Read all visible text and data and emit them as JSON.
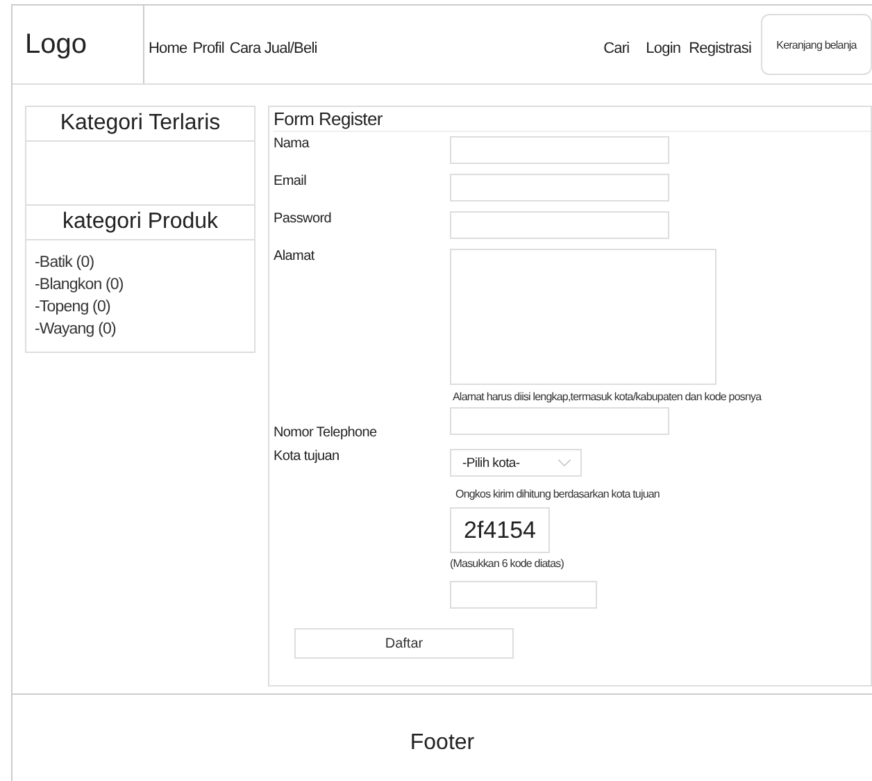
{
  "header": {
    "logo": "Logo",
    "nav_left": [
      "Home",
      "Profil",
      "Cara Jual/Beli"
    ],
    "nav_right": [
      "Cari",
      "Login",
      "Registrasi"
    ],
    "cart_button": "Keranjang belanja"
  },
  "sidebar": {
    "bestseller_title": "Kategori Terlaris",
    "category_title": "kategori Produk",
    "categories": [
      "-Batik (0)",
      "-Blangkon (0)",
      "-Topeng (0)",
      "-Wayang (0)"
    ]
  },
  "form": {
    "title": "Form Register",
    "fields": [
      {
        "kind": "input",
        "label": "Nama"
      },
      {
        "kind": "input",
        "label": "Email"
      },
      {
        "kind": "input",
        "label": "Password"
      },
      {
        "kind": "textarea",
        "label": "Alamat",
        "note": "Alamat harus diisi lengkap,termasuk kota/kabupaten dan kode posnya"
      },
      {
        "kind": "input",
        "label": "Nomor Telephone"
      },
      {
        "kind": "select",
        "label": "Kota tujuan",
        "value": "-Pilih kota-",
        "note": "Ongkos kirim dihitung berdasarkan kota tujuan"
      },
      {
        "kind": "captcha",
        "code": "2f4154",
        "note": "(Masukkan 6 kode diatas)"
      }
    ],
    "submit": "Daftar"
  },
  "footer": {
    "text": "Footer"
  }
}
